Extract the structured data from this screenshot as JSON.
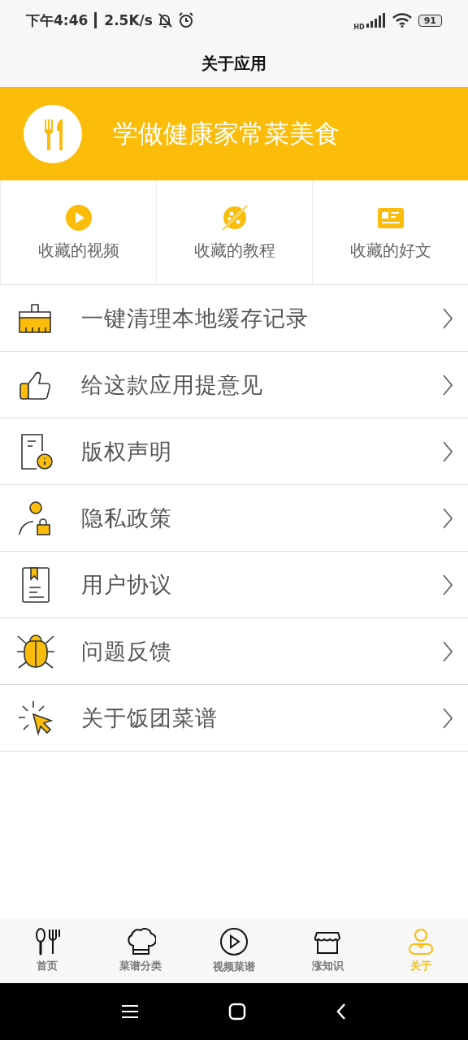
{
  "status_bar": {
    "time": "下午4:46",
    "speed": "2.5K/s",
    "network": "HD",
    "battery": "91"
  },
  "title": "关于应用",
  "banner": {
    "text": "学做健康家常菜美食"
  },
  "favorites": [
    {
      "label": "收藏的视频"
    },
    {
      "label": "收藏的教程"
    },
    {
      "label": "收藏的好文"
    }
  ],
  "menu": [
    {
      "label": "一键清理本地缓存记录"
    },
    {
      "label": "给这款应用提意见"
    },
    {
      "label": "版权声明"
    },
    {
      "label": "隐私政策"
    },
    {
      "label": "用户协议"
    },
    {
      "label": "问题反馈"
    },
    {
      "label": "关于饭团菜谱"
    }
  ],
  "bottom_nav": [
    {
      "label": "首页",
      "selected": false
    },
    {
      "label": "菜谱分类",
      "selected": false
    },
    {
      "label": "视频菜谱",
      "selected": false
    },
    {
      "label": "涨知识",
      "selected": false
    },
    {
      "label": "关于",
      "selected": true
    }
  ]
}
